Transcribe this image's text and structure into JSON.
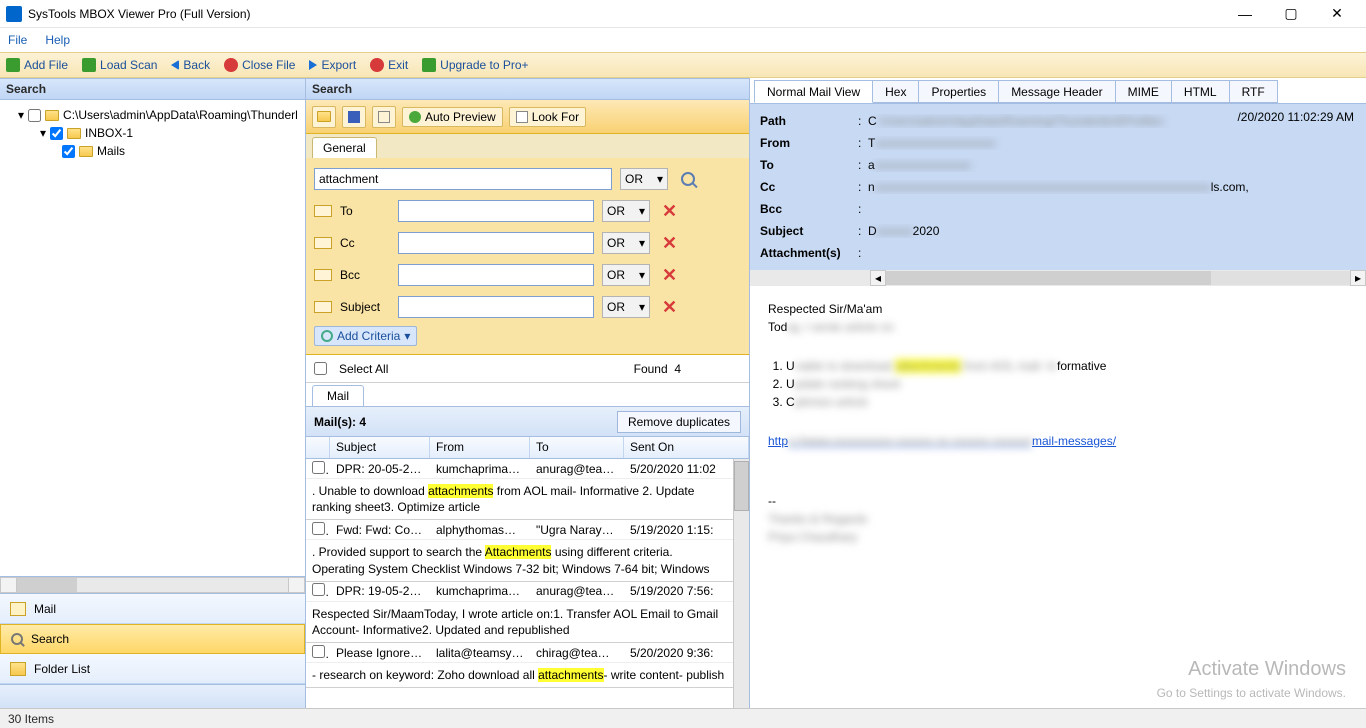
{
  "app": {
    "title": "SysTools MBOX Viewer Pro (Full Version)"
  },
  "menu": {
    "file": "File",
    "help": "Help"
  },
  "toolbar": {
    "add_file": "Add File",
    "load_scan": "Load Scan",
    "back": "Back",
    "close_file": "Close File",
    "export": "Export",
    "exit": "Exit",
    "upgrade": "Upgrade to Pro+"
  },
  "left": {
    "title": "Search",
    "tree": {
      "root": "C:\\Users\\admin\\AppData\\Roaming\\Thunderl",
      "inbox": "INBOX-1",
      "mails": "Mails"
    },
    "nav": {
      "mail": "Mail",
      "search": "Search",
      "folder_list": "Folder List"
    }
  },
  "search": {
    "title": "Search",
    "auto_preview": "Auto Preview",
    "look_for": "Look For",
    "general_tab": "General",
    "main_value": "attachment",
    "op": "OR",
    "fields": {
      "to": "To",
      "cc": "Cc",
      "bcc": "Bcc",
      "subject": "Subject"
    },
    "add_criteria": "Add Criteria",
    "select_all": "Select All",
    "found_label": "Found",
    "found_count": "4",
    "mail_tab": "Mail",
    "mails_label": "Mail(s):  4",
    "remove_dup": "Remove duplicates",
    "columns": {
      "subject": "Subject",
      "from": "From",
      "to": "To",
      "sent": "Sent On"
    },
    "rows": [
      {
        "subject": "DPR: 20-05-2020",
        "from": "kumchapriman@...",
        "to": "anurag@teamsysto...",
        "sent": "5/20/2020 11:02",
        "snippet_a": ". Unable to download ",
        "snippet_hl": "attachments",
        "snippet_b": " from AOL mail- Informative 2. Update ranking sheet3. Optimize article"
      },
      {
        "subject": "Fwd: Fwd: Congr...",
        "from": "alphythomas@te...",
        "to": "\"Ugra Narayan P...",
        "sent": "5/19/2020 1:15:",
        "snippet_a": ". Provided support to search the ",
        "snippet_hl": "Attachments",
        "snippet_b": " using different criteria. Operating System Checklist    Windows 7-32 bit; Windows 7-64 bit; Windows"
      },
      {
        "subject": "DPR: 19-05-2020",
        "from": "kumchapriman@...",
        "to": "anurag@teamsysto...",
        "sent": "5/19/2020 7:56:",
        "snippet_a": "Respected Sir/MaamToday, I wrote article on:1. Transfer AOL Email to Gmail Account- Informative2. Updated and republished",
        "snippet_hl": "",
        "snippet_b": ""
      },
      {
        "subject": "Please Ignore Pr...",
        "from": "lalita@teamsysto...",
        "to": "chirag@teamsyst...",
        "sent": "5/20/2020 9:36:",
        "snippet_a": "- research on keyword: Zoho download all ",
        "snippet_hl": "attachments",
        "snippet_b": "- write content- publish"
      }
    ]
  },
  "preview": {
    "tabs": {
      "normal": "Normal Mail View",
      "hex": "Hex",
      "properties": "Properties",
      "header": "Message Header",
      "mime": "MIME",
      "html": "HTML",
      "rtf": "RTF"
    },
    "meta": {
      "path_l": "Path",
      "from_l": "From",
      "to_l": "To",
      "cc_l": "Cc",
      "bcc_l": "Bcc",
      "subject_l": "Subject",
      "attach_l": "Attachment(s)",
      "date": "/20/2020 11:02:29 AM",
      "path_v": "C",
      "from_v": "T",
      "to_v": "a",
      "cc_v": "n",
      "cc_tail": "ls.com,",
      "subject_v": "D",
      "subject_tail": "2020"
    },
    "body": {
      "greet": "Respected Sir/Ma'am",
      "today": "Tod",
      "li1a": "U",
      "li1b": "formative",
      "li2": "U",
      "li3": "C",
      "link_a": "http",
      "link_b": "mail-messages/"
    }
  },
  "status": {
    "items": "30 Items"
  },
  "watermark": {
    "l1": "Activate Windows",
    "l2": "Go to Settings to activate Windows."
  }
}
